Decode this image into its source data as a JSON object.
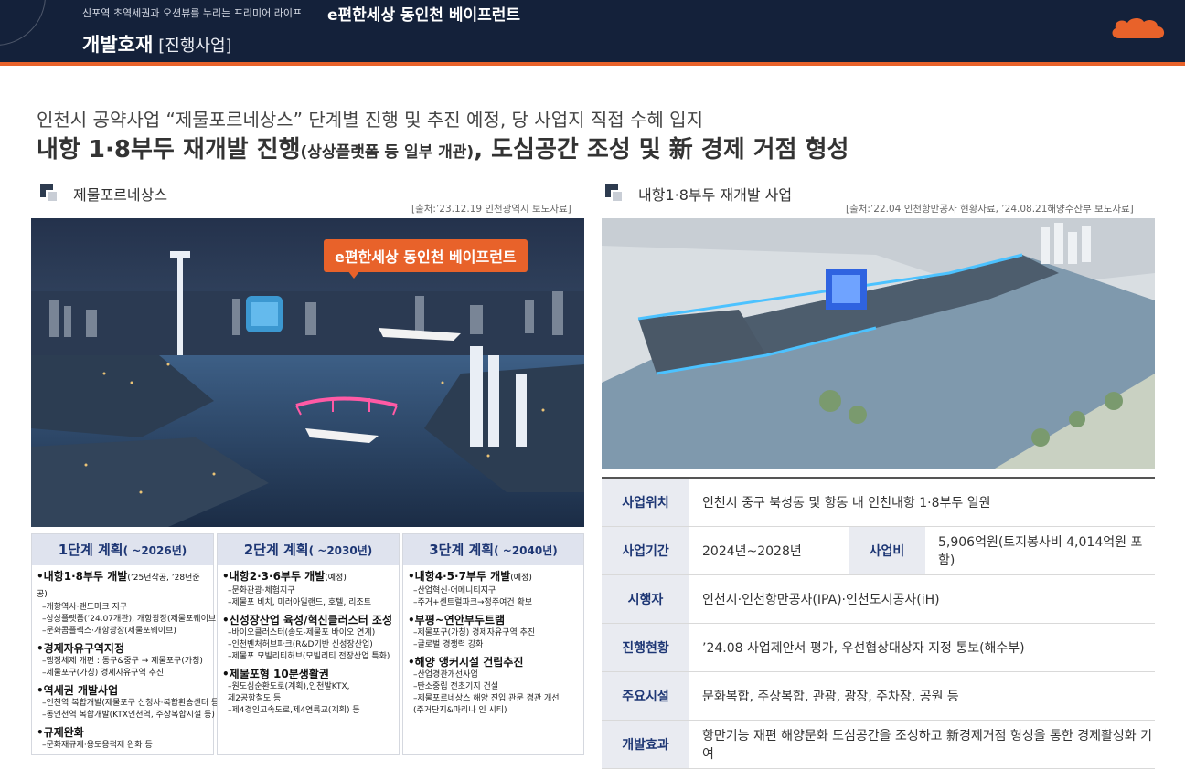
{
  "header": {
    "tagline": "신포역 초역세권과 오션뷰를 누리는 프리미어 라이프",
    "brand": "e편한세상 동인천 베이프런트",
    "title": "개발호재",
    "subtitle": "[진행사업]"
  },
  "headline": {
    "line1": "인천시 공약사업 “제물포르네상스” 단계별 진행 및 추진 예정, 당 사업지 직접 수혜 입지",
    "line2_a": "내항 1·8부두 재개발 진행",
    "line2_b": "(상상플랫폼 등 일부 개관)",
    "line2_c": ", 도심공간 조성 및 新 경제 거점 형성"
  },
  "left_section": {
    "title": "제물포르네상스",
    "source": "[출처:’23.12.19 인천광역시 보도자료]",
    "image_tag": "e편한세상 동인천 베이프런트"
  },
  "right_section": {
    "title": "내항1·8부두 재개발 사업",
    "source": "[출처:’22.04 인천항만공사 현황자료, ’24.08.21해양수산부 보도자료]"
  },
  "phases": [
    {
      "title": "1단계 계획",
      "year": "( ~2026년)",
      "groups": [
        {
          "title": "•내항1·8부두 개발",
          "sub": "(’25년착공, ’28년준공)",
          "items": [
            "–개항역사·랜드마크 지구",
            "–상상플랫폼(’24.07개관), 개항광장(제물포웨이브)",
            "–문화콤플렉스·개항광장(제물포웨이브)"
          ]
        },
        {
          "title": "•경제자유구역지정",
          "sub": "",
          "items": [
            "–행정체제 개편 : 동구&중구 → 제물포구(가칭)",
            "–제물포구(가칭) 경제자유구역 추진"
          ]
        },
        {
          "title": "•역세권 개발사업",
          "sub": "",
          "items": [
            "–인천역 복합개발(제물포구 신청사·복합환승센터 등)",
            "–동인천역 복합개발(KTX인천역, 주상복합시설 등)"
          ]
        },
        {
          "title": "•규제완화",
          "sub": "",
          "items": [
            "–문화재규제·용도용적제 완화 등"
          ]
        }
      ]
    },
    {
      "title": "2단계 계획",
      "year": "( ~2030년)",
      "groups": [
        {
          "title": "•내항2·3·6부두 개발",
          "sub": "(예정)",
          "items": [
            "–문화관광·체험지구",
            "–제물포 비치, 미러아일랜드, 호텔, 리조트"
          ]
        },
        {
          "title": "•신성장산업 육성/혁신클러스터 조성",
          "sub": "",
          "items": [
            "–바이오클러스터(송도-제물포 바이오 연계)",
            "–인천벤처허브파크(R&D기반 신성장산업)",
            "–제물포 모빌리티허브(모빌리티 전장산업 특화)"
          ]
        },
        {
          "title": "•제물포형 10분생활권",
          "sub": "",
          "items": [
            "–원도심순환도로(계획),인천발KTX,",
            "  제2공항철도 등",
            "–제4경인고속도로,제4연륙교(계획) 등"
          ]
        }
      ]
    },
    {
      "title": "3단계 계획",
      "year": "( ~2040년)",
      "groups": [
        {
          "title": "•내항4·5·7부두 개발",
          "sub": "(예정)",
          "items": [
            "–산업혁신·어메니티지구",
            "–주거+센트럴파크→정주여건 확보"
          ]
        },
        {
          "title": "•부평~연안부두트램",
          "sub": "",
          "items": [
            "–제물포구(가칭) 경제자유구역 추진",
            "–글로벌 경쟁력 강화"
          ]
        },
        {
          "title": "•해양 앵커시설 건립추진",
          "sub": "",
          "items": [
            "–산업경관개선사업",
            "–탄소중립 전초기지 건설",
            "–제물포르네상스 해양 진입 관문 경관 개선",
            "  (주거단지&마리나 인 시티)"
          ]
        }
      ]
    }
  ],
  "info_table": {
    "location_label": "사업위치",
    "location_value": "인천시 중구 북성동 및 항동 내 인천내항 1·8부두 일원",
    "period_label": "사업기간",
    "period_value": "2024년~2028년",
    "cost_label": "사업비",
    "cost_value": "5,906억원(토지봉사비 4,014억원 포함)",
    "operator_label": "시행자",
    "operator_value": "인천시·인천항만공사(IPA)·인천도시공사(iH)",
    "status_label": "진행현황",
    "status_value": "’24.08  사업제안서 평가, 우선협상대상자 지정 통보(해수부)",
    "facilities_label": "주요시설",
    "facilities_value": "문화복합, 주상복합, 관광, 광장, 주차장, 공원 등",
    "effect_label": "개발효과",
    "effect_value": "항만기능 재편 해양문화 도심공간을 조성하고 新경제거점 형성을 통한 경제활성화 기여"
  },
  "colors": {
    "header_bg": "#14213a",
    "accent_orange": "#e8622a",
    "navy_text": "#1d3674"
  }
}
